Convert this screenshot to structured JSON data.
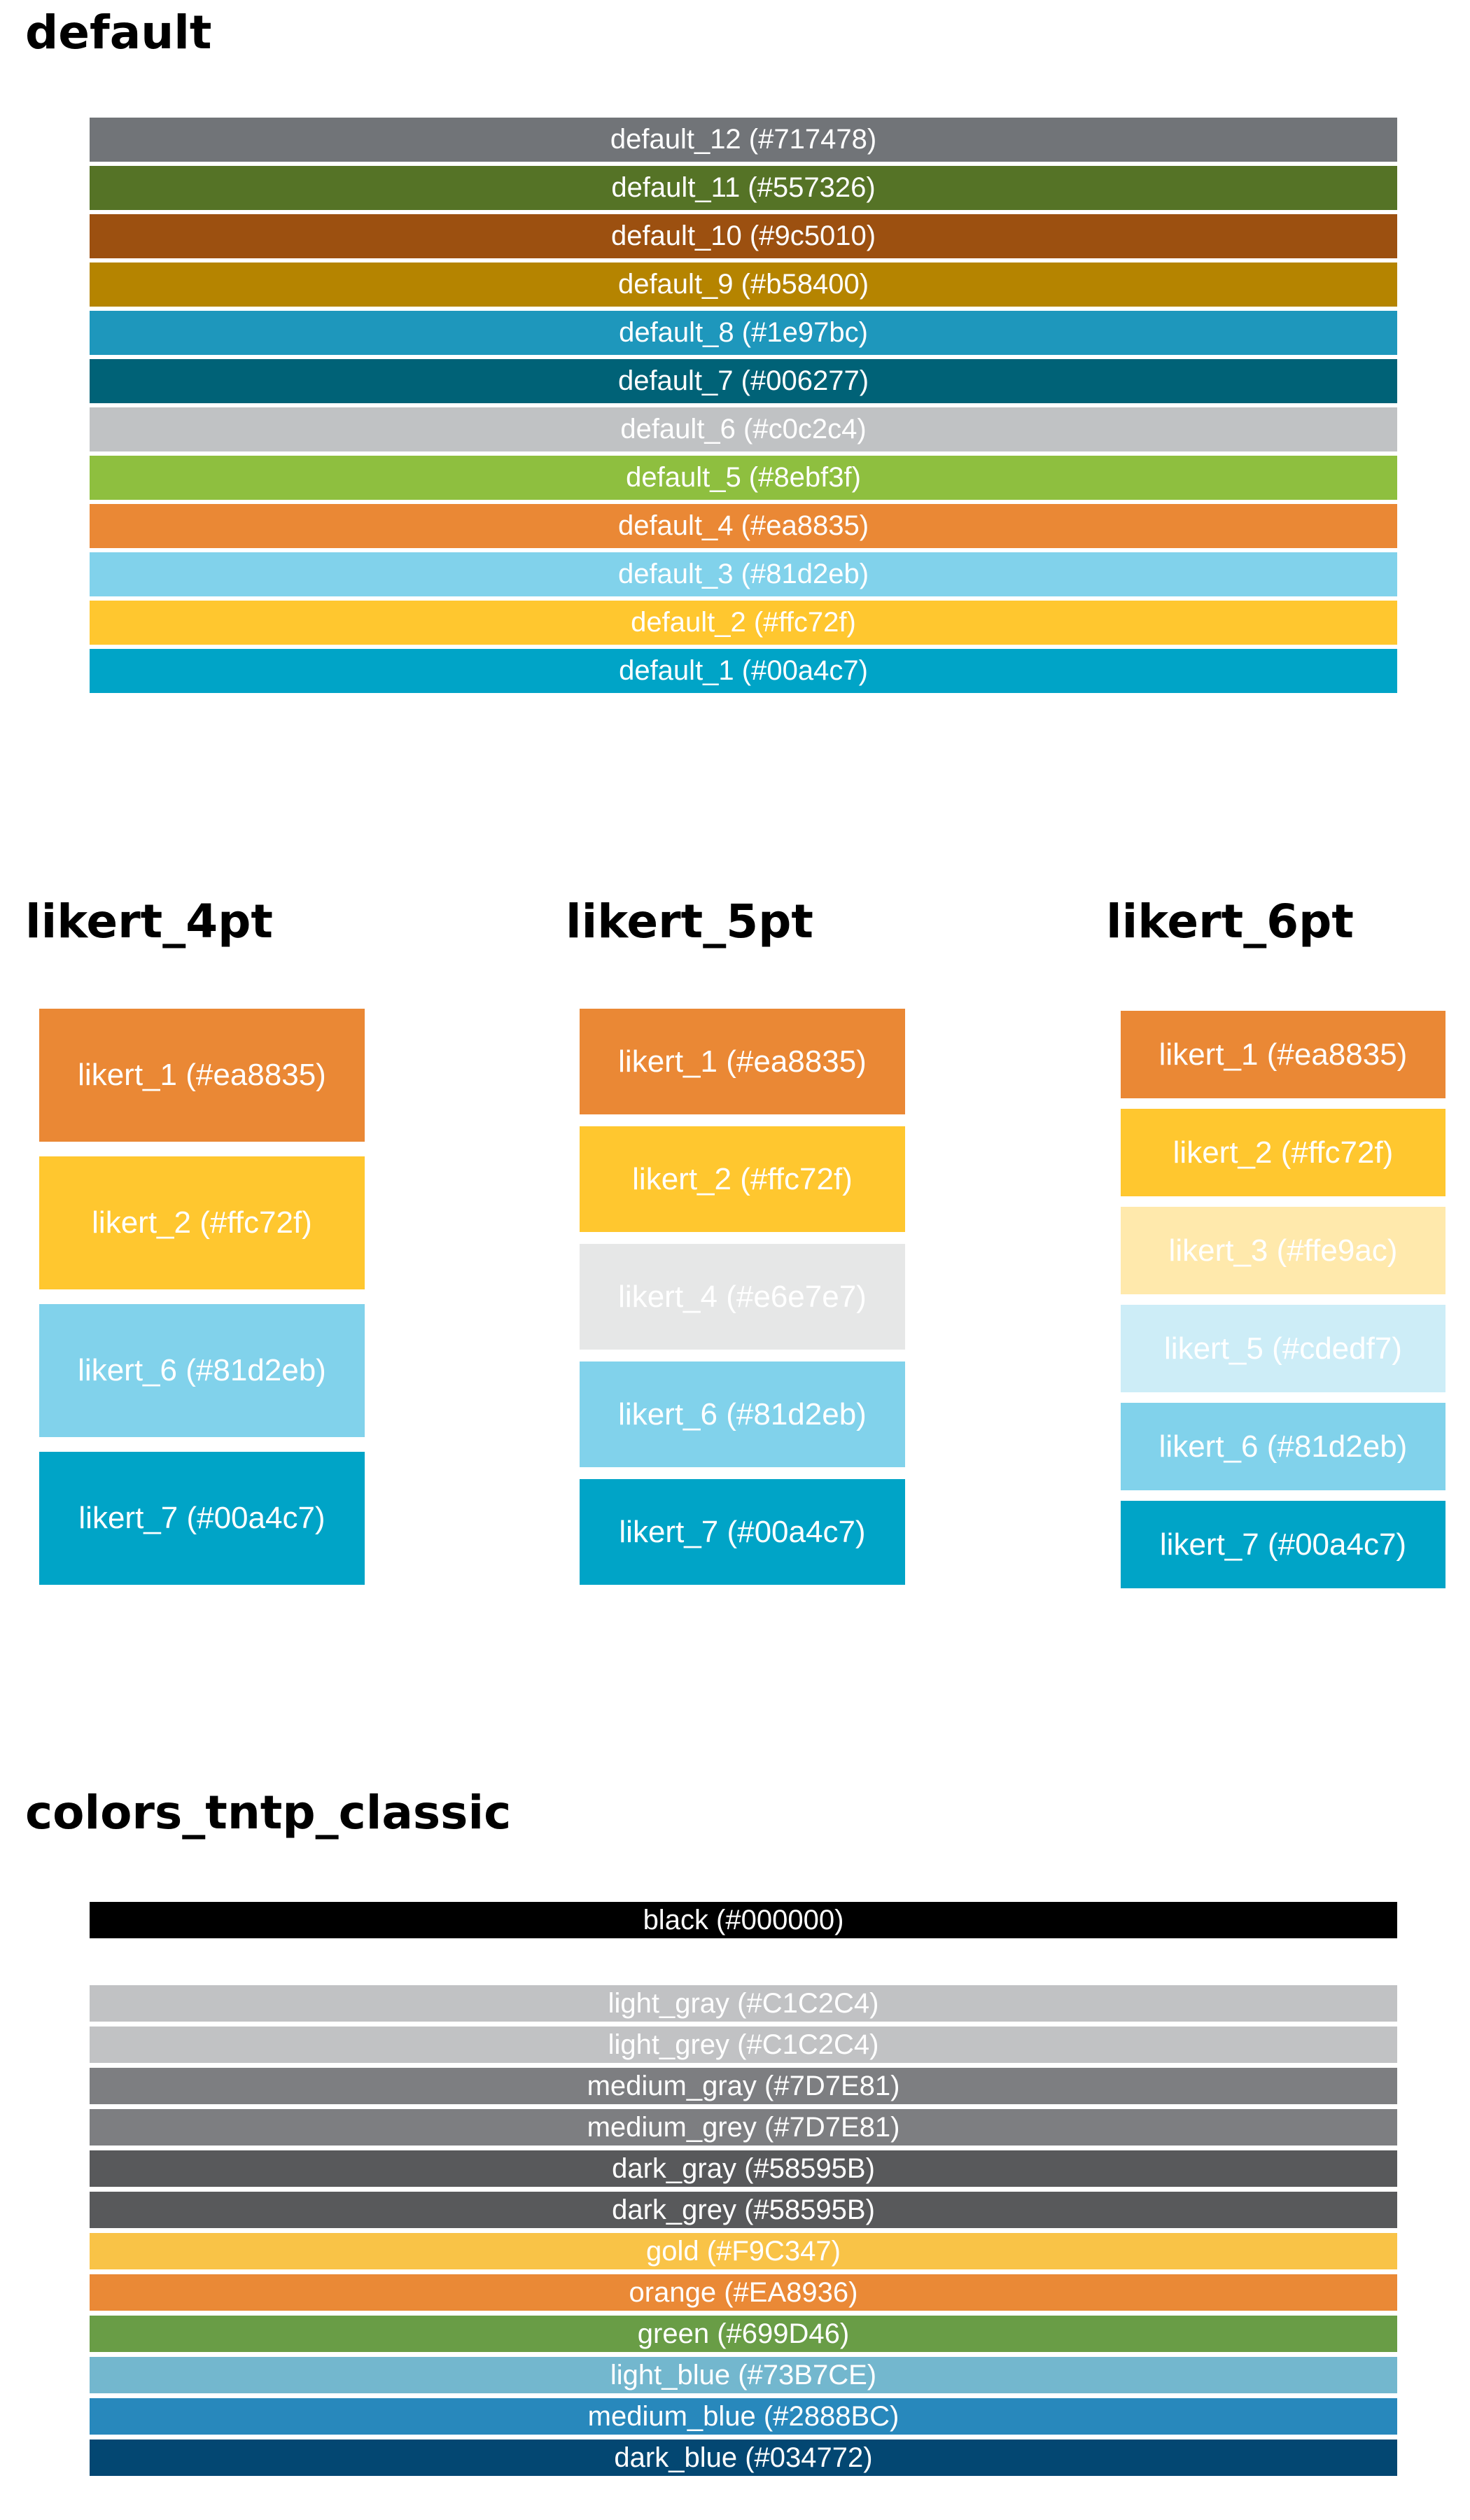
{
  "sections": {
    "default": {
      "title": "default",
      "swatches": [
        {
          "label": "default_12 (#717478)",
          "color": "#717478"
        },
        {
          "label": "default_11 (#557326)",
          "color": "#557326"
        },
        {
          "label": "default_10 (#9c5010)",
          "color": "#9c5010"
        },
        {
          "label": "default_9 (#b58400)",
          "color": "#b58400"
        },
        {
          "label": "default_8 (#1e97bc)",
          "color": "#1e97bc"
        },
        {
          "label": "default_7 (#006277)",
          "color": "#006277"
        },
        {
          "label": "default_6 (#c0c2c4)",
          "color": "#c0c2c4"
        },
        {
          "label": "default_5 (#8ebf3f)",
          "color": "#8ebf3f"
        },
        {
          "label": "default_4 (#ea8835)",
          "color": "#ea8835"
        },
        {
          "label": "default_3 (#81d2eb)",
          "color": "#81d2eb"
        },
        {
          "label": "default_2 (#ffc72f)",
          "color": "#ffc72f"
        },
        {
          "label": "default_1 (#00a4c7)",
          "color": "#00a4c7"
        }
      ]
    },
    "likert_4pt": {
      "title": "likert_4pt",
      "swatches": [
        {
          "label": "likert_1 (#ea8835)",
          "color": "#ea8835"
        },
        {
          "label": "likert_2 (#ffc72f)",
          "color": "#ffc72f"
        },
        {
          "label": "likert_6 (#81d2eb)",
          "color": "#81d2eb"
        },
        {
          "label": "likert_7 (#00a4c7)",
          "color": "#00a4c7"
        }
      ]
    },
    "likert_5pt": {
      "title": "likert_5pt",
      "swatches": [
        {
          "label": "likert_1 (#ea8835)",
          "color": "#ea8835"
        },
        {
          "label": "likert_2 (#ffc72f)",
          "color": "#ffc72f"
        },
        {
          "label": "likert_4 (#e6e7e7)",
          "color": "#e6e7e7"
        },
        {
          "label": "likert_6 (#81d2eb)",
          "color": "#81d2eb"
        },
        {
          "label": "likert_7 (#00a4c7)",
          "color": "#00a4c7"
        }
      ]
    },
    "likert_6pt": {
      "title": "likert_6pt",
      "swatches": [
        {
          "label": "likert_1 (#ea8835)",
          "color": "#ea8835"
        },
        {
          "label": "likert_2 (#ffc72f)",
          "color": "#ffc72f"
        },
        {
          "label": "likert_3 (#ffe9ac)",
          "color": "#ffe9ac"
        },
        {
          "label": "likert_5 (#cdedf7)",
          "color": "#cdedf7"
        },
        {
          "label": "likert_6 (#81d2eb)",
          "color": "#81d2eb"
        },
        {
          "label": "likert_7 (#00a4c7)",
          "color": "#00a4c7"
        }
      ]
    },
    "colors_tntp_classic": {
      "title": "colors_tntp_classic",
      "black_swatches": [
        {
          "label": "black (#000000)",
          "color": "#000000"
        }
      ],
      "swatches": [
        {
          "label": "light_gray (#C1C2C4)",
          "color": "#C1C2C4"
        },
        {
          "label": "light_grey (#C1C2C4)",
          "color": "#C1C2C4"
        },
        {
          "label": "medium_gray (#7D7E81)",
          "color": "#7D7E81"
        },
        {
          "label": "medium_grey (#7D7E81)",
          "color": "#7D7E81"
        },
        {
          "label": "dark_gray (#58595B)",
          "color": "#58595B"
        },
        {
          "label": "dark_grey (#58595B)",
          "color": "#58595B"
        },
        {
          "label": "gold (#F9C347)",
          "color": "#F9C347"
        },
        {
          "label": "orange (#EA8936)",
          "color": "#EA8936"
        },
        {
          "label": "green (#699D46)",
          "color": "#699D46"
        },
        {
          "label": "light_blue (#73B7CE)",
          "color": "#73B7CE"
        },
        {
          "label": "medium_blue (#2888BC)",
          "color": "#2888BC"
        },
        {
          "label": "dark_blue (#034772)",
          "color": "#034772"
        }
      ]
    }
  }
}
